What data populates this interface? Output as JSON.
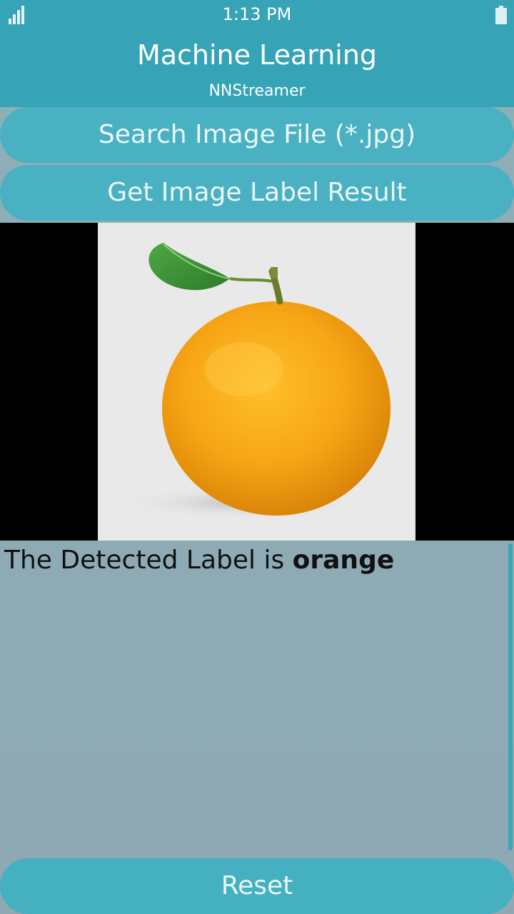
{
  "status_bar": {
    "time": "1:13 PM",
    "signal_icon": "signal-bars-icon",
    "battery_icon": "battery-icon"
  },
  "header": {
    "title": "Machine Learning",
    "subtitle": "NNStreamer"
  },
  "buttons": {
    "search_label": "Search Image File (*.jpg)",
    "get_label_label": "Get Image Label Result",
    "reset_label": "Reset"
  },
  "image": {
    "subject": "orange-fruit-image"
  },
  "result": {
    "prefix": "The Detected Label is ",
    "label": "orange"
  },
  "colors": {
    "header_bg": "#36a3b6",
    "button_bg": "#4ab1c2",
    "result_bg": "#8db0b6"
  }
}
